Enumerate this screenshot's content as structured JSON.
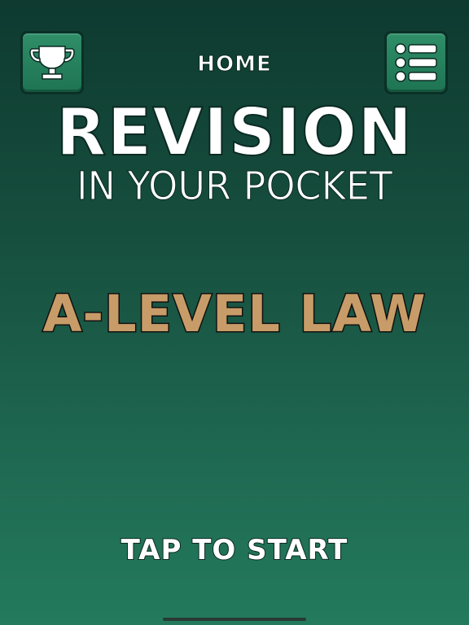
{
  "header": {
    "title": "HOME",
    "trophy_icon": "trophy-icon",
    "menu_icon": "list-menu-icon"
  },
  "logo": {
    "main": "REVISION",
    "sub": "IN YOUR POCKET"
  },
  "subject": {
    "label": "A-LEVEL LAW"
  },
  "start": {
    "label": "TAP TO START"
  },
  "colors": {
    "background_top": "#0e3a30",
    "background_bottom": "#237a5c",
    "button_green": "#2f8e68",
    "subject_tan": "#c89c68",
    "text_white": "#ffffff"
  }
}
